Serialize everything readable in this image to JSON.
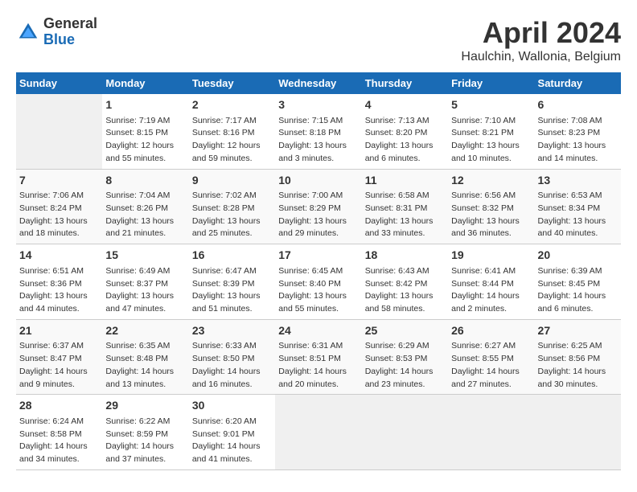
{
  "header": {
    "logo_general": "General",
    "logo_blue": "Blue",
    "title": "April 2024",
    "subtitle": "Haulchin, Wallonia, Belgium"
  },
  "days_of_week": [
    "Sunday",
    "Monday",
    "Tuesday",
    "Wednesday",
    "Thursday",
    "Friday",
    "Saturday"
  ],
  "weeks": [
    [
      {
        "num": "",
        "info": ""
      },
      {
        "num": "1",
        "info": "Sunrise: 7:19 AM\nSunset: 8:15 PM\nDaylight: 12 hours\nand 55 minutes."
      },
      {
        "num": "2",
        "info": "Sunrise: 7:17 AM\nSunset: 8:16 PM\nDaylight: 12 hours\nand 59 minutes."
      },
      {
        "num": "3",
        "info": "Sunrise: 7:15 AM\nSunset: 8:18 PM\nDaylight: 13 hours\nand 3 minutes."
      },
      {
        "num": "4",
        "info": "Sunrise: 7:13 AM\nSunset: 8:20 PM\nDaylight: 13 hours\nand 6 minutes."
      },
      {
        "num": "5",
        "info": "Sunrise: 7:10 AM\nSunset: 8:21 PM\nDaylight: 13 hours\nand 10 minutes."
      },
      {
        "num": "6",
        "info": "Sunrise: 7:08 AM\nSunset: 8:23 PM\nDaylight: 13 hours\nand 14 minutes."
      }
    ],
    [
      {
        "num": "7",
        "info": "Sunrise: 7:06 AM\nSunset: 8:24 PM\nDaylight: 13 hours\nand 18 minutes."
      },
      {
        "num": "8",
        "info": "Sunrise: 7:04 AM\nSunset: 8:26 PM\nDaylight: 13 hours\nand 21 minutes."
      },
      {
        "num": "9",
        "info": "Sunrise: 7:02 AM\nSunset: 8:28 PM\nDaylight: 13 hours\nand 25 minutes."
      },
      {
        "num": "10",
        "info": "Sunrise: 7:00 AM\nSunset: 8:29 PM\nDaylight: 13 hours\nand 29 minutes."
      },
      {
        "num": "11",
        "info": "Sunrise: 6:58 AM\nSunset: 8:31 PM\nDaylight: 13 hours\nand 33 minutes."
      },
      {
        "num": "12",
        "info": "Sunrise: 6:56 AM\nSunset: 8:32 PM\nDaylight: 13 hours\nand 36 minutes."
      },
      {
        "num": "13",
        "info": "Sunrise: 6:53 AM\nSunset: 8:34 PM\nDaylight: 13 hours\nand 40 minutes."
      }
    ],
    [
      {
        "num": "14",
        "info": "Sunrise: 6:51 AM\nSunset: 8:36 PM\nDaylight: 13 hours\nand 44 minutes."
      },
      {
        "num": "15",
        "info": "Sunrise: 6:49 AM\nSunset: 8:37 PM\nDaylight: 13 hours\nand 47 minutes."
      },
      {
        "num": "16",
        "info": "Sunrise: 6:47 AM\nSunset: 8:39 PM\nDaylight: 13 hours\nand 51 minutes."
      },
      {
        "num": "17",
        "info": "Sunrise: 6:45 AM\nSunset: 8:40 PM\nDaylight: 13 hours\nand 55 minutes."
      },
      {
        "num": "18",
        "info": "Sunrise: 6:43 AM\nSunset: 8:42 PM\nDaylight: 13 hours\nand 58 minutes."
      },
      {
        "num": "19",
        "info": "Sunrise: 6:41 AM\nSunset: 8:44 PM\nDaylight: 14 hours\nand 2 minutes."
      },
      {
        "num": "20",
        "info": "Sunrise: 6:39 AM\nSunset: 8:45 PM\nDaylight: 14 hours\nand 6 minutes."
      }
    ],
    [
      {
        "num": "21",
        "info": "Sunrise: 6:37 AM\nSunset: 8:47 PM\nDaylight: 14 hours\nand 9 minutes."
      },
      {
        "num": "22",
        "info": "Sunrise: 6:35 AM\nSunset: 8:48 PM\nDaylight: 14 hours\nand 13 minutes."
      },
      {
        "num": "23",
        "info": "Sunrise: 6:33 AM\nSunset: 8:50 PM\nDaylight: 14 hours\nand 16 minutes."
      },
      {
        "num": "24",
        "info": "Sunrise: 6:31 AM\nSunset: 8:51 PM\nDaylight: 14 hours\nand 20 minutes."
      },
      {
        "num": "25",
        "info": "Sunrise: 6:29 AM\nSunset: 8:53 PM\nDaylight: 14 hours\nand 23 minutes."
      },
      {
        "num": "26",
        "info": "Sunrise: 6:27 AM\nSunset: 8:55 PM\nDaylight: 14 hours\nand 27 minutes."
      },
      {
        "num": "27",
        "info": "Sunrise: 6:25 AM\nSunset: 8:56 PM\nDaylight: 14 hours\nand 30 minutes."
      }
    ],
    [
      {
        "num": "28",
        "info": "Sunrise: 6:24 AM\nSunset: 8:58 PM\nDaylight: 14 hours\nand 34 minutes."
      },
      {
        "num": "29",
        "info": "Sunrise: 6:22 AM\nSunset: 8:59 PM\nDaylight: 14 hours\nand 37 minutes."
      },
      {
        "num": "30",
        "info": "Sunrise: 6:20 AM\nSunset: 9:01 PM\nDaylight: 14 hours\nand 41 minutes."
      },
      {
        "num": "",
        "info": ""
      },
      {
        "num": "",
        "info": ""
      },
      {
        "num": "",
        "info": ""
      },
      {
        "num": "",
        "info": ""
      }
    ]
  ]
}
